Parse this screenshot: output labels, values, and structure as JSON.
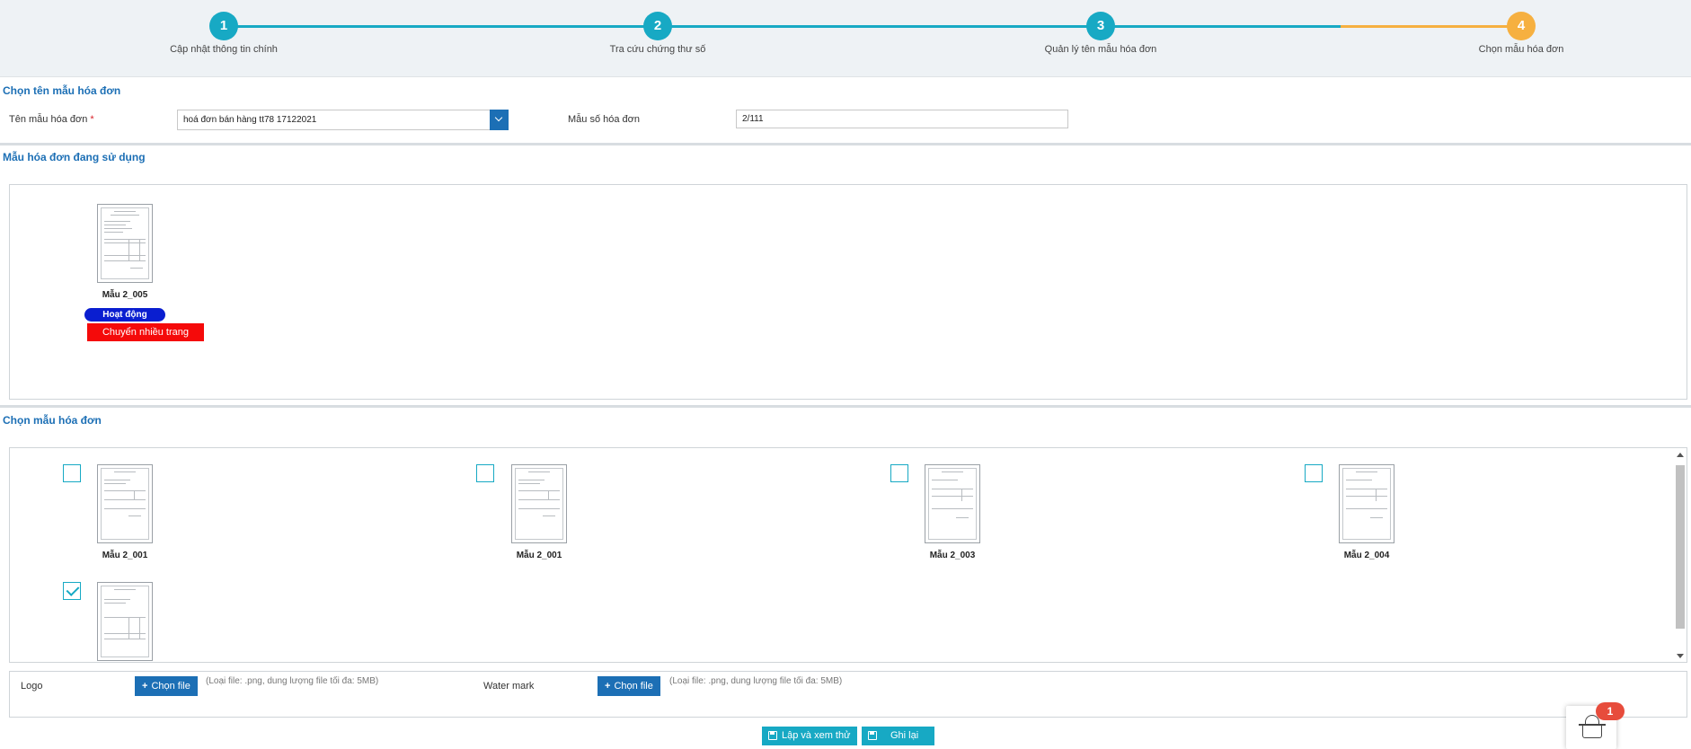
{
  "stepper": {
    "steps": [
      {
        "number": "1",
        "label": "Cập nhật thông tin chính"
      },
      {
        "number": "2",
        "label": "Tra cứu chứng thư số"
      },
      {
        "number": "3",
        "label": "Quản lý tên mẫu hóa đơn"
      },
      {
        "number": "4",
        "label": "Chọn mẫu hóa đơn"
      }
    ],
    "active_step": 4,
    "colors": {
      "done": "#17a9c4",
      "active": "#f6b040"
    }
  },
  "select_name_section": {
    "title": "Chọn tên mẫu hóa đơn",
    "template_name_label": "Tên mẫu hóa đơn",
    "required_mark": "*",
    "template_name_value": "hoá đơn bán hàng tt78 17122021",
    "template_number_label": "Mẫu số hóa đơn",
    "template_number_value": "2/111"
  },
  "in_use_section": {
    "title": "Mẫu hóa đơn đang sử dụng",
    "template": {
      "name": "Mẫu 2_005",
      "status": "Hoạt động",
      "multipage_button": "Chuyển nhiều trang"
    },
    "colors": {
      "status": "#0a1ed0",
      "multipage": "#f50a0a"
    }
  },
  "choose_section": {
    "title": "Chọn mẫu hóa đơn",
    "templates": [
      {
        "name": "Mẫu 2_001",
        "checked": false
      },
      {
        "name": "Mẫu 2_001",
        "checked": false
      },
      {
        "name": "Mẫu 2_003",
        "checked": false
      },
      {
        "name": "Mẫu 2_004",
        "checked": false
      },
      {
        "name": "",
        "checked": true
      }
    ]
  },
  "upload": {
    "logo_label": "Logo",
    "logo_button": "Chọn file",
    "logo_hint": "(Loại file: .png, dung lượng file tối đa: 5MB)",
    "watermark_label": "Water mark",
    "watermark_button": "Chọn file",
    "watermark_hint": "(Loại file: .png, dung lượng file tối đa: 5MB)"
  },
  "actions": {
    "preview_button": "Lập và xem thử",
    "save_button": "Ghi lại"
  },
  "cart": {
    "count": "1",
    "icon": "basket-icon"
  }
}
